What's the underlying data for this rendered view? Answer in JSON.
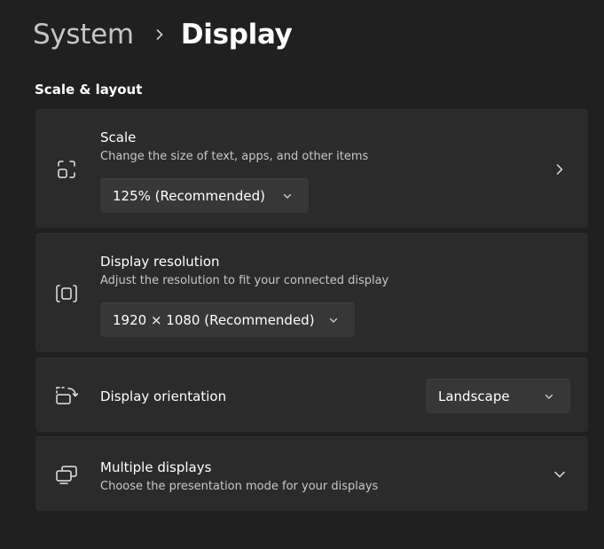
{
  "breadcrumb": {
    "parent": "System",
    "current": "Display"
  },
  "section": {
    "title": "Scale & layout"
  },
  "cards": {
    "scale": {
      "title": "Scale",
      "subtitle": "Change the size of text, apps, and other items",
      "dropdown_value": "125% (Recommended)",
      "icon": "scale-icon",
      "action_icon": "chevron-right-icon"
    },
    "resolution": {
      "title": "Display resolution",
      "subtitle": "Adjust the resolution to fit your connected display",
      "dropdown_value": "1920 × 1080 (Recommended)",
      "icon": "resolution-icon"
    },
    "orientation": {
      "title": "Display orientation",
      "dropdown_value": "Landscape",
      "icon": "orientation-icon"
    },
    "multiple": {
      "title": "Multiple displays",
      "subtitle": "Choose the presentation mode for your displays",
      "icon": "multiple-displays-icon",
      "action_icon": "chevron-down-icon"
    }
  },
  "colors": {
    "background": "#202020",
    "card": "#2b2b2b",
    "dropdown": "#373737",
    "text": "#ffffff",
    "subtext": "#c8c8c8"
  }
}
